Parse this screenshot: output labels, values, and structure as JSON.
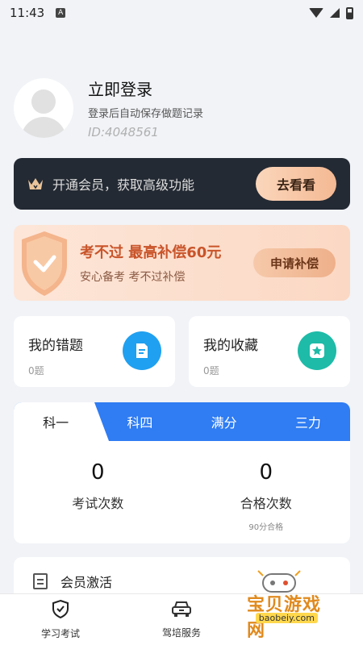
{
  "status_bar": {
    "time": "11:43",
    "notif_glyph": "A"
  },
  "profile": {
    "title": "立即登录",
    "subtitle": "登录后自动保存做题记录",
    "id_text": "ID:4048561"
  },
  "vip": {
    "text": "开通会员，获取高级功能",
    "button": "去看看"
  },
  "compensation": {
    "title": "考不过 最高补偿60元",
    "subtitle": "安心备考 考不过补偿",
    "button": "申请补偿"
  },
  "cards": {
    "mistakes": {
      "title": "我的错题",
      "count": "0题",
      "icon": "document-icon"
    },
    "favorites": {
      "title": "我的收藏",
      "count": "0题",
      "icon": "star-icon"
    }
  },
  "exam": {
    "tabs": [
      {
        "label": "科一"
      },
      {
        "label": "科四"
      },
      {
        "label": "满分"
      },
      {
        "label": "三力"
      }
    ],
    "active_tab": 0,
    "stats": {
      "exam_count": {
        "value": "0",
        "label": "考试次数"
      },
      "pass_count": {
        "value": "0",
        "label": "合格次数",
        "note": "90分合格"
      }
    }
  },
  "list": {
    "activation_label": "会员激活"
  },
  "bottom_nav": [
    {
      "label": "学习考试",
      "icon": "shield-check-icon"
    },
    {
      "label": "驾培服务",
      "icon": "car-icon"
    }
  ],
  "watermark": {
    "text": "宝贝游戏网",
    "url": "baobeiy.com"
  },
  "colors": {
    "tab_blue": "#2f7cf3",
    "vip_dark": "#242a33",
    "vip_gold": "#f4b993",
    "comp_orange": "#c9542a",
    "icon_blue": "#20a0f0",
    "icon_teal": "#1dbba8"
  }
}
